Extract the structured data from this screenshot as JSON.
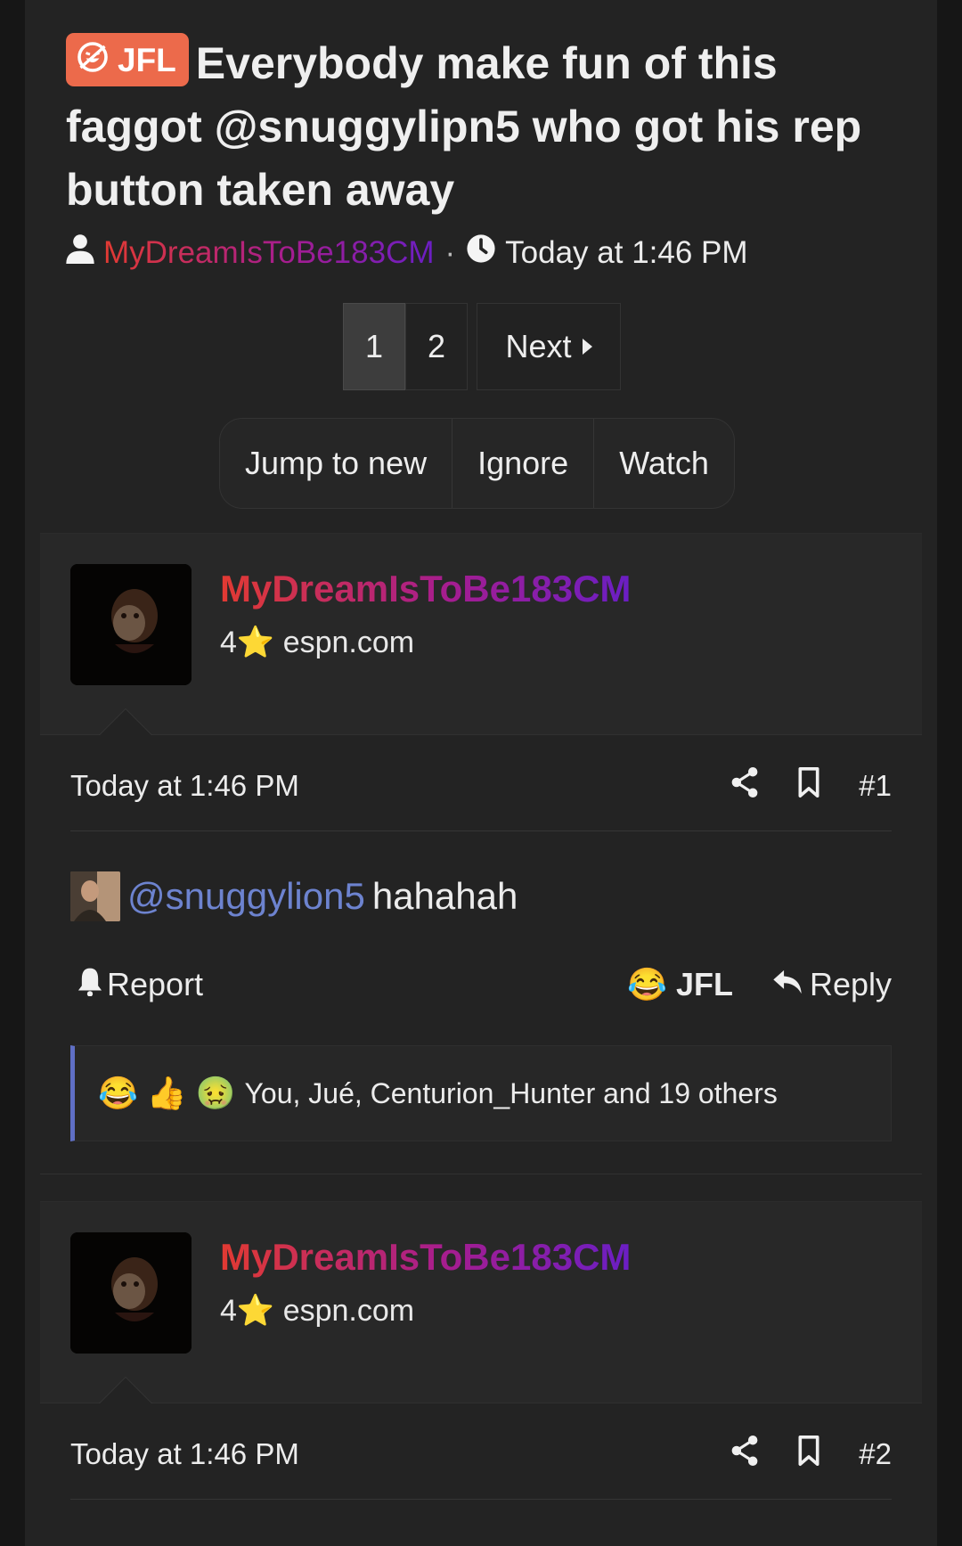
{
  "thread": {
    "prefix": "JFL",
    "title": "Everybody make fun of this faggot @snuggylipn5 who got his rep button taken away",
    "author": "MyDreamIsToBe183CM",
    "separator": "·",
    "time": "Today at 1:46 PM"
  },
  "pagination": {
    "pages": [
      "1",
      "2"
    ],
    "current": "1",
    "next": "Next"
  },
  "actions": {
    "jump": "Jump to new",
    "ignore": "Ignore",
    "watch": "Watch"
  },
  "posts": [
    {
      "username": "MyDreamIsToBe183CM",
      "rank": "4⭐ espn.com",
      "time": "Today at 1:46 PM",
      "number": "#1",
      "mention": "@snuggylion5",
      "text": "hahahah",
      "report": "Report",
      "reaction_emoji": "😂",
      "reaction": "JFL",
      "reply": "Reply",
      "reaction_icons": [
        "😂",
        "👍",
        "🤢"
      ],
      "reaction_summary": "You, Jué, Centurion_Hunter and 19 others"
    },
    {
      "username": "MyDreamIsToBe183CM",
      "rank": "4⭐ espn.com",
      "time": "Today at 1:46 PM",
      "number": "#2"
    }
  ],
  "colors": {
    "prefix_bg": "#ec6a4b",
    "mention": "#6d83cf",
    "accent_border": "#5f6fc5"
  },
  "icons": [
    "prefix-laugh-icon",
    "user-icon",
    "clock-icon",
    "share-icon",
    "bookmark-icon",
    "bell-icon",
    "reply-icon"
  ]
}
